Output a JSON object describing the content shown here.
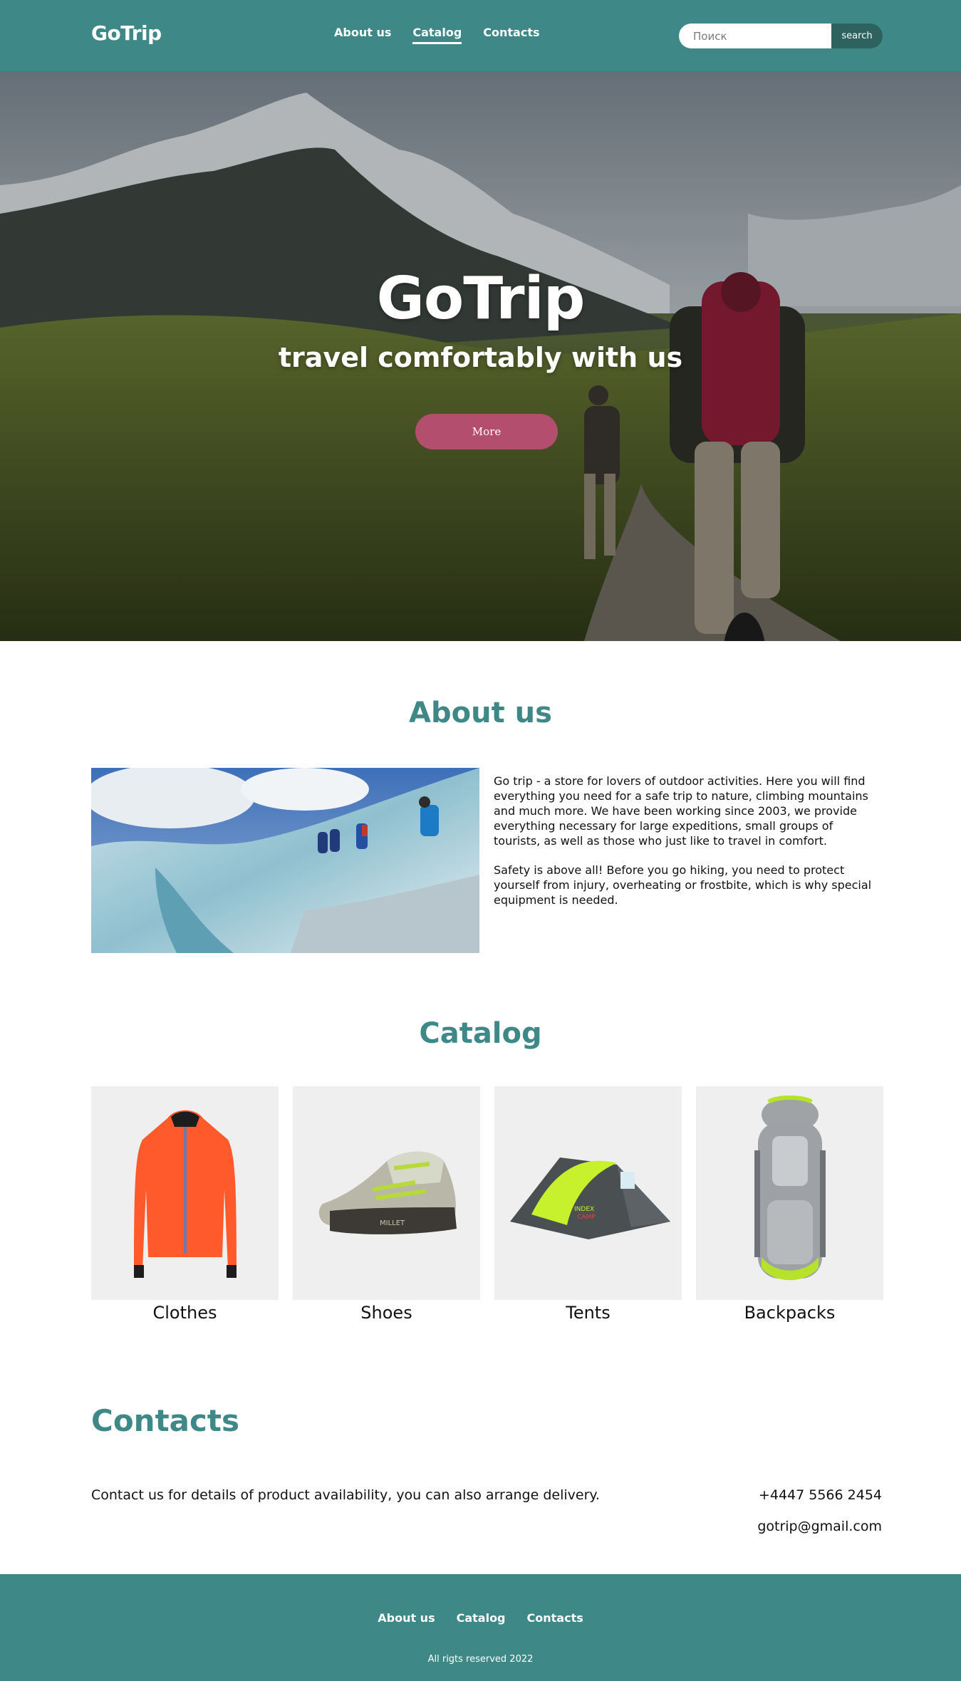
{
  "header": {
    "logo": "GoTrip",
    "nav": [
      {
        "label": "About us",
        "active": false
      },
      {
        "label": "Catalog",
        "active": true
      },
      {
        "label": "Contacts",
        "active": false
      }
    ],
    "search": {
      "placeholder": "Поиск",
      "button_label": "search"
    }
  },
  "hero": {
    "title": "GoTrip",
    "subtitle": "travel comfortably with us",
    "button_label": "More"
  },
  "about": {
    "title": "About us",
    "paragraphs": [
      "Go trip - a store for lovers of outdoor activities. Here you will find everything you need for a safe trip to nature, climbing mountains and much more. We have been working since 2003, we provide everything necessary for large expeditions, small groups of tourists, as well as those who just like to travel in comfort.",
      "Safety is above all! Before you go hiking, you need to protect yourself from injury, overheating or frostbite, which is why special equipment is needed."
    ]
  },
  "catalog": {
    "title": "Catalog",
    "items": [
      {
        "label": "Clothes",
        "icon": "jacket-icon"
      },
      {
        "label": "Shoes",
        "icon": "shoe-icon"
      },
      {
        "label": "Tents",
        "icon": "tent-icon"
      },
      {
        "label": "Backpacks",
        "icon": "backpack-icon"
      }
    ]
  },
  "contacts": {
    "title": "Contacts",
    "description": "Contact us for details of product availability, you can also arrange delivery.",
    "phone": "+4447 5566 2454",
    "email": "gotrip@gmail.com"
  },
  "footer": {
    "nav": [
      "About us",
      "Catalog",
      "Contacts"
    ],
    "copyright": "All rigts reserved 2022"
  },
  "colors": {
    "primary": "#3e8987",
    "search_button": "#2d625f",
    "accent_button": "#b44e6e",
    "card_bg": "#efefef"
  }
}
